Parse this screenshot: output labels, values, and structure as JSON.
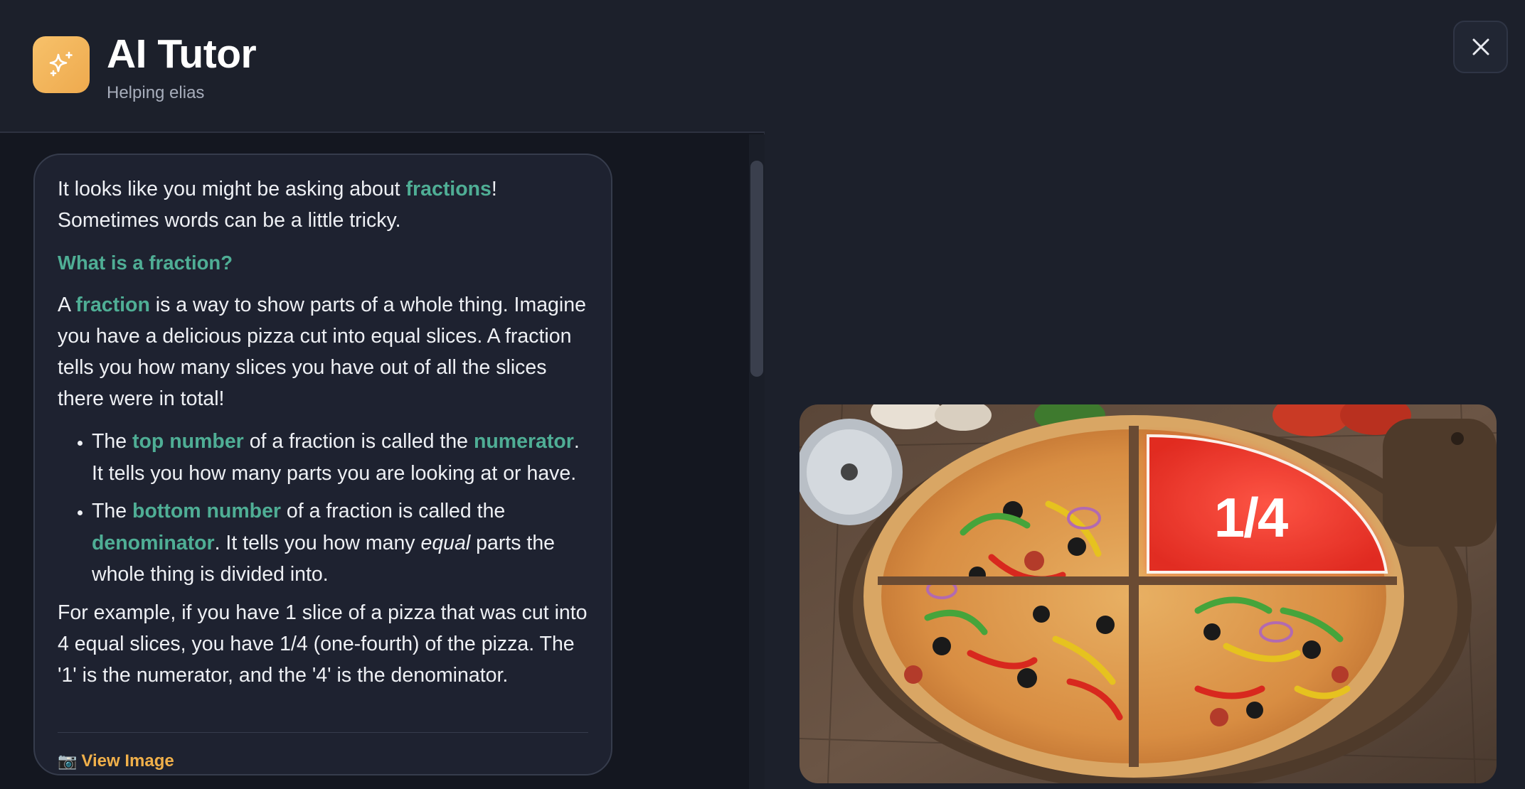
{
  "app": {
    "title": "AI Tutor",
    "subtitle": "Helping elias",
    "icon": "sparkle-icon"
  },
  "message": {
    "intro_1": "It looks like you might be asking about ",
    "intro_hl": "fractions",
    "intro_2": "!",
    "intro_line2": "Sometimes words can be a little tricky.",
    "heading": "What is a fraction?",
    "p1_a": "A ",
    "p1_hl": "fraction",
    "p1_b": " is a way to show parts of a whole thing. Imagine you have a delicious pizza cut into equal slices. A fraction tells you how many slices you have out of all the slices there were in total!",
    "bullets": [
      {
        "a": "The ",
        "hl1": "top number",
        "b": " of a fraction is called the ",
        "hl2": "numerator",
        "c": ". It tells you how many parts you are looking at or have."
      },
      {
        "a": "The ",
        "hl1": "bottom number",
        "b": " of a fraction is called the ",
        "hl2": "denominator",
        "c1": ". It tells you how many ",
        "em": "equal",
        "c2": " parts the whole thing is divided into."
      }
    ],
    "example": "For example, if you have 1 slice of a pizza that was cut into 4 equal slices, you have 1/4 (one-fourth) of the pizza. The '1' is the numerator, and the '4' is the denominator.",
    "view_image_icon": "📷",
    "view_image_label": "View Image"
  },
  "image": {
    "fraction_label": "1/4",
    "description_icon": "pizza-image"
  },
  "colors": {
    "accent_green": "#4fae95",
    "accent_orange": "#f0b04a",
    "icon_bg": "#f4b85e"
  }
}
